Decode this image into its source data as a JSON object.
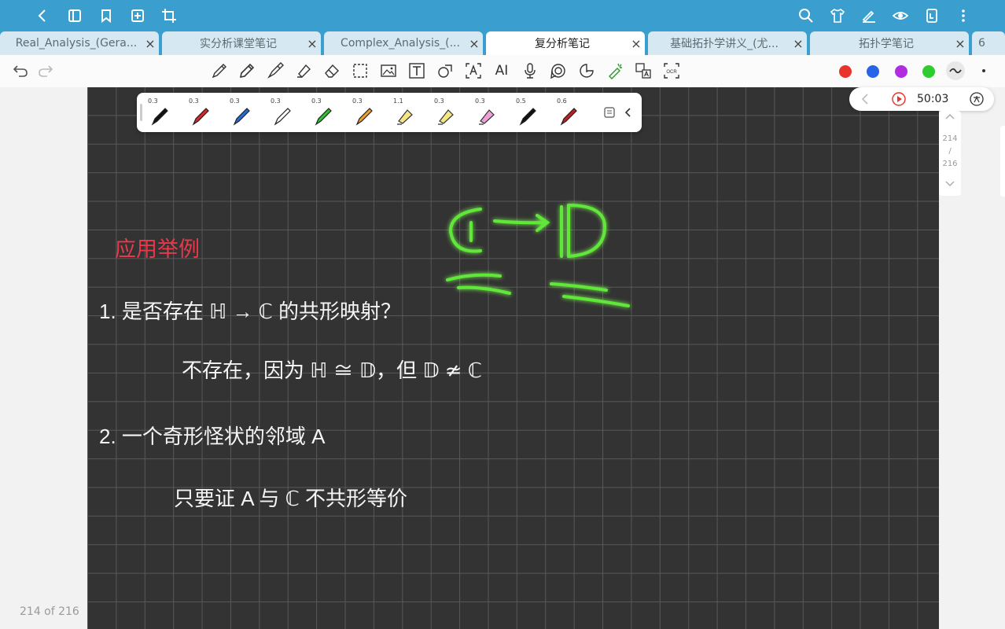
{
  "topbar": {
    "icons": [
      "back-icon",
      "sidebar-icon",
      "bookmark-icon",
      "add-page-icon",
      "crop-icon",
      "search-icon",
      "theme-icon",
      "pen-mode-icon",
      "read-mode-icon",
      "export-icon",
      "more-icon"
    ]
  },
  "tabs": [
    {
      "label": "Real_Analysis_(Gera...",
      "active": false
    },
    {
      "label": "实分析课堂笔记",
      "active": false
    },
    {
      "label": "Complex_Analysis_(...",
      "active": false
    },
    {
      "label": "复分析笔记",
      "active": true
    },
    {
      "label": "基础拓扑学讲义_(尤...",
      "active": false
    },
    {
      "label": "拓扑学笔记",
      "active": false
    },
    {
      "label": "6",
      "active": false
    }
  ],
  "tab_close": "×",
  "toolbar": {
    "tools": [
      "pen-icon",
      "pencil-icon",
      "fountain-pen-icon",
      "highlighter-icon",
      "eraser-icon",
      "lasso-icon",
      "image-icon",
      "text-icon",
      "shape-icon",
      "text-recognize-icon",
      "ai-icon",
      "microphone-icon",
      "tape-icon",
      "sticker-icon",
      "laser-pointer-icon",
      "translate-icon",
      "ocr-icon"
    ],
    "ai_label": "AI",
    "ocr_label": "OCR",
    "colors": [
      "#e8342a",
      "#2864e8",
      "#b12be0",
      "#2ecc2e"
    ]
  },
  "pen_palette": {
    "pens": [
      {
        "size": "0.3",
        "color": "#111111"
      },
      {
        "size": "0.3",
        "color": "#d8282a"
      },
      {
        "size": "0.3",
        "color": "#2a6ad8"
      },
      {
        "size": "0.3",
        "color": "#111111"
      },
      {
        "size": "0.3",
        "color": "#2ec62e"
      },
      {
        "size": "0.3",
        "color": "#f0a030"
      },
      {
        "size": "1.1",
        "color": "#f5e680"
      },
      {
        "size": "0.3",
        "color": "#f5e680"
      },
      {
        "size": "0.3",
        "color": "#f0a0d8"
      },
      {
        "size": "0.5",
        "color": "#111111"
      },
      {
        "size": "0.6",
        "color": "#c02020"
      }
    ]
  },
  "recording": {
    "time": "50:03"
  },
  "page_nav": {
    "current": "214",
    "separator": "/",
    "total": "216"
  },
  "footer": {
    "page_count": "214 of 216"
  },
  "note": {
    "heading": "应用举例",
    "item1": "1. 是否存在 ℍ → ℂ 的共形映射？",
    "item1_answer": "不存在，因为 ℍ ≅ 𝔻，但 𝔻 ≄ ℂ",
    "item2": "2. 一个奇形怪状的邻域 A",
    "item2_answer": "只要证 A 与 ℂ 不共形等价",
    "diagram": "ℂ → 𝔻"
  }
}
